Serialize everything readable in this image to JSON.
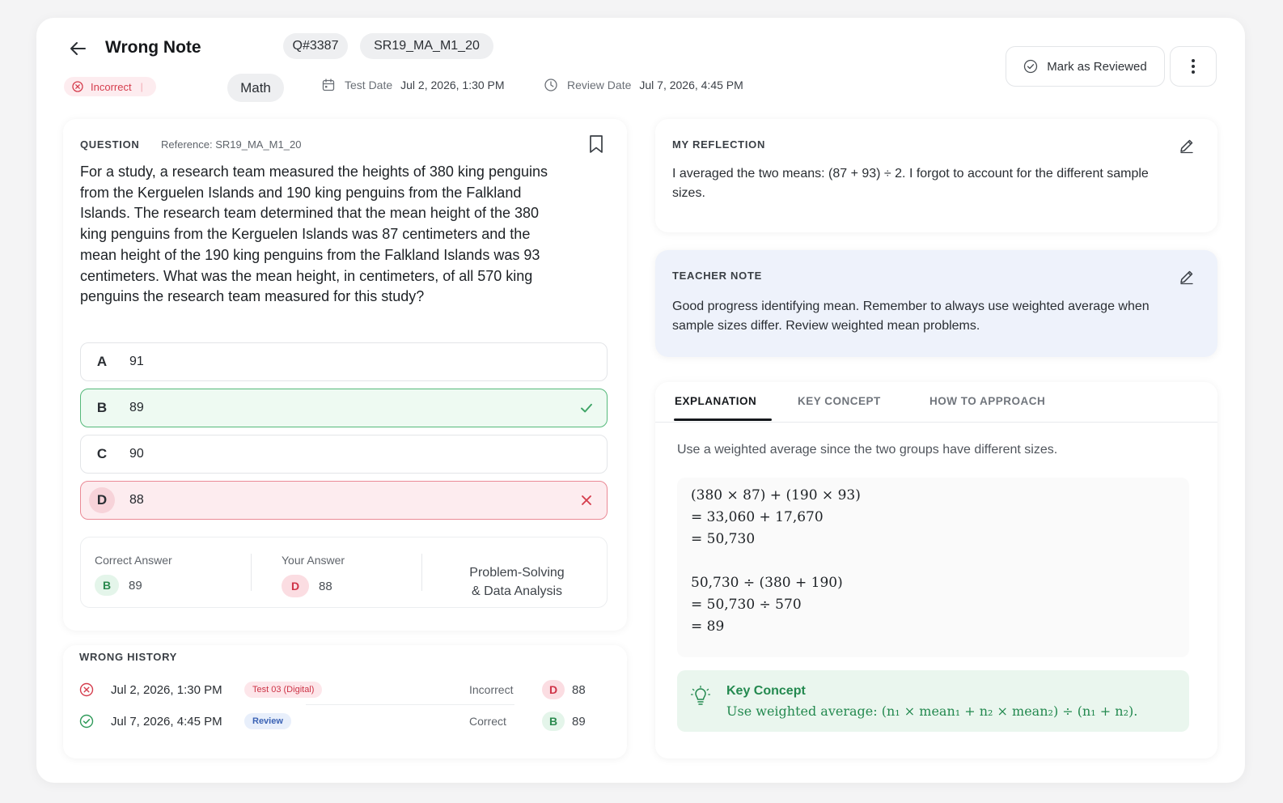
{
  "header": {
    "title": "Wrong Note",
    "question_id": "Q#3387",
    "question_code": "SR19_MA_M1_20",
    "status": "Incorrect",
    "subject": "Math",
    "test_date_label": "Test Date",
    "test_date": "Jul 2, 2026, 1:30 PM",
    "review_date_label": "Review Date",
    "review_date": "Jul 7, 2026, 4:45 PM",
    "mark_reviewed_label": "Mark as Reviewed"
  },
  "question": {
    "label": "QUESTION",
    "reference": "Reference: SR19_MA_M1_20",
    "text": "For a study, a research team measured the heights of 380 king penguins from the Kerguelen Islands and 190 king penguins from the Falkland Islands. The research team determined that the mean height of the 380 king penguins from the Kerguelen Islands was 87 centimeters and the mean height of the 190 king penguins from the Falkland Islands was 93 centimeters. What was the mean height, in centimeters, of all 570 king penguins the research team measured for this study?",
    "options": [
      {
        "letter": "A",
        "value": "91",
        "state": "neutral"
      },
      {
        "letter": "B",
        "value": "89",
        "state": "correct"
      },
      {
        "letter": "C",
        "value": "90",
        "state": "neutral"
      },
      {
        "letter": "D",
        "value": "88",
        "state": "wrong"
      }
    ],
    "summary": {
      "correct_label": "Correct Answer",
      "correct_letter": "B",
      "correct_value": "89",
      "your_label": "Your Answer",
      "your_letter": "D",
      "your_value": "88",
      "domain_line1": "Problem-Solving",
      "domain_line2": "& Data Analysis"
    }
  },
  "history": {
    "label": "WRONG HISTORY",
    "rows": [
      {
        "date": "Jul 2, 2026, 1:30 PM",
        "tag": "Test 03 (Digital)",
        "status": "Incorrect",
        "letter": "D",
        "value": "88"
      },
      {
        "date": "Jul 7, 2026, 4:45 PM",
        "tag": "Review",
        "status": "Correct",
        "letter": "B",
        "value": "89"
      }
    ]
  },
  "reflection": {
    "label": "MY REFLECTION",
    "text": "I averaged the two means: (87 + 93) ÷ 2. I forgot to account for the different sample sizes."
  },
  "teacher": {
    "label": "TEACHER NOTE",
    "text": "Good progress identifying mean. Remember to always use weighted average when sample sizes differ. Review weighted mean problems."
  },
  "explanation": {
    "tabs": [
      "EXPLANATION",
      "KEY CONCEPT",
      "HOW TO APPROACH"
    ],
    "intro": "Use a weighted average since the two groups have different sizes.",
    "math": [
      "(380 × 87)  +  (190 × 93)",
      "=  33,060  +  17,670",
      "=  50,730",
      "50,730  ÷  (380  +  190)",
      "=  50,730  ÷  570",
      "=  89"
    ],
    "key_concept_title": "Key Concept",
    "key_concept_text": "Use weighted average: (n₁ × mean₁ + n₂ × mean₂) ÷ (n₁ + n₂)."
  },
  "colors": {
    "correct": "#55b97a",
    "wrong": "#ea8a96",
    "teacher_bg": "#eef2fb",
    "key_concept_bg": "#eaf6ee"
  }
}
